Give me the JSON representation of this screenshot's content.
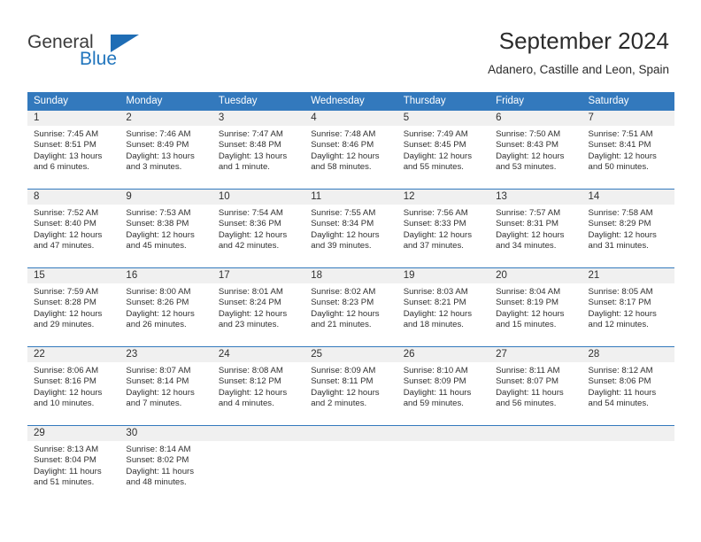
{
  "brand": {
    "name_part1": "General",
    "name_part2": "Blue",
    "triangle_icon": "blue-triangle-icon",
    "accent_color": "#2175bd"
  },
  "header": {
    "title": "September 2024",
    "subtitle": "Adanero, Castille and Leon, Spain"
  },
  "calendar": {
    "header_bg_color": "#3379bd",
    "day_number_bg_color": "#f0f0f0",
    "weekdays": [
      "Sunday",
      "Monday",
      "Tuesday",
      "Wednesday",
      "Thursday",
      "Friday",
      "Saturday"
    ],
    "weeks": [
      [
        {
          "day": "1",
          "sunrise": "Sunrise: 7:45 AM",
          "sunset": "Sunset: 8:51 PM",
          "daylight": "Daylight: 13 hours and 6 minutes."
        },
        {
          "day": "2",
          "sunrise": "Sunrise: 7:46 AM",
          "sunset": "Sunset: 8:49 PM",
          "daylight": "Daylight: 13 hours and 3 minutes."
        },
        {
          "day": "3",
          "sunrise": "Sunrise: 7:47 AM",
          "sunset": "Sunset: 8:48 PM",
          "daylight": "Daylight: 13 hours and 1 minute."
        },
        {
          "day": "4",
          "sunrise": "Sunrise: 7:48 AM",
          "sunset": "Sunset: 8:46 PM",
          "daylight": "Daylight: 12 hours and 58 minutes."
        },
        {
          "day": "5",
          "sunrise": "Sunrise: 7:49 AM",
          "sunset": "Sunset: 8:45 PM",
          "daylight": "Daylight: 12 hours and 55 minutes."
        },
        {
          "day": "6",
          "sunrise": "Sunrise: 7:50 AM",
          "sunset": "Sunset: 8:43 PM",
          "daylight": "Daylight: 12 hours and 53 minutes."
        },
        {
          "day": "7",
          "sunrise": "Sunrise: 7:51 AM",
          "sunset": "Sunset: 8:41 PM",
          "daylight": "Daylight: 12 hours and 50 minutes."
        }
      ],
      [
        {
          "day": "8",
          "sunrise": "Sunrise: 7:52 AM",
          "sunset": "Sunset: 8:40 PM",
          "daylight": "Daylight: 12 hours and 47 minutes."
        },
        {
          "day": "9",
          "sunrise": "Sunrise: 7:53 AM",
          "sunset": "Sunset: 8:38 PM",
          "daylight": "Daylight: 12 hours and 45 minutes."
        },
        {
          "day": "10",
          "sunrise": "Sunrise: 7:54 AM",
          "sunset": "Sunset: 8:36 PM",
          "daylight": "Daylight: 12 hours and 42 minutes."
        },
        {
          "day": "11",
          "sunrise": "Sunrise: 7:55 AM",
          "sunset": "Sunset: 8:34 PM",
          "daylight": "Daylight: 12 hours and 39 minutes."
        },
        {
          "day": "12",
          "sunrise": "Sunrise: 7:56 AM",
          "sunset": "Sunset: 8:33 PM",
          "daylight": "Daylight: 12 hours and 37 minutes."
        },
        {
          "day": "13",
          "sunrise": "Sunrise: 7:57 AM",
          "sunset": "Sunset: 8:31 PM",
          "daylight": "Daylight: 12 hours and 34 minutes."
        },
        {
          "day": "14",
          "sunrise": "Sunrise: 7:58 AM",
          "sunset": "Sunset: 8:29 PM",
          "daylight": "Daylight: 12 hours and 31 minutes."
        }
      ],
      [
        {
          "day": "15",
          "sunrise": "Sunrise: 7:59 AM",
          "sunset": "Sunset: 8:28 PM",
          "daylight": "Daylight: 12 hours and 29 minutes."
        },
        {
          "day": "16",
          "sunrise": "Sunrise: 8:00 AM",
          "sunset": "Sunset: 8:26 PM",
          "daylight": "Daylight: 12 hours and 26 minutes."
        },
        {
          "day": "17",
          "sunrise": "Sunrise: 8:01 AM",
          "sunset": "Sunset: 8:24 PM",
          "daylight": "Daylight: 12 hours and 23 minutes."
        },
        {
          "day": "18",
          "sunrise": "Sunrise: 8:02 AM",
          "sunset": "Sunset: 8:23 PM",
          "daylight": "Daylight: 12 hours and 21 minutes."
        },
        {
          "day": "19",
          "sunrise": "Sunrise: 8:03 AM",
          "sunset": "Sunset: 8:21 PM",
          "daylight": "Daylight: 12 hours and 18 minutes."
        },
        {
          "day": "20",
          "sunrise": "Sunrise: 8:04 AM",
          "sunset": "Sunset: 8:19 PM",
          "daylight": "Daylight: 12 hours and 15 minutes."
        },
        {
          "day": "21",
          "sunrise": "Sunrise: 8:05 AM",
          "sunset": "Sunset: 8:17 PM",
          "daylight": "Daylight: 12 hours and 12 minutes."
        }
      ],
      [
        {
          "day": "22",
          "sunrise": "Sunrise: 8:06 AM",
          "sunset": "Sunset: 8:16 PM",
          "daylight": "Daylight: 12 hours and 10 minutes."
        },
        {
          "day": "23",
          "sunrise": "Sunrise: 8:07 AM",
          "sunset": "Sunset: 8:14 PM",
          "daylight": "Daylight: 12 hours and 7 minutes."
        },
        {
          "day": "24",
          "sunrise": "Sunrise: 8:08 AM",
          "sunset": "Sunset: 8:12 PM",
          "daylight": "Daylight: 12 hours and 4 minutes."
        },
        {
          "day": "25",
          "sunrise": "Sunrise: 8:09 AM",
          "sunset": "Sunset: 8:11 PM",
          "daylight": "Daylight: 12 hours and 2 minutes."
        },
        {
          "day": "26",
          "sunrise": "Sunrise: 8:10 AM",
          "sunset": "Sunset: 8:09 PM",
          "daylight": "Daylight: 11 hours and 59 minutes."
        },
        {
          "day": "27",
          "sunrise": "Sunrise: 8:11 AM",
          "sunset": "Sunset: 8:07 PM",
          "daylight": "Daylight: 11 hours and 56 minutes."
        },
        {
          "day": "28",
          "sunrise": "Sunrise: 8:12 AM",
          "sunset": "Sunset: 8:06 PM",
          "daylight": "Daylight: 11 hours and 54 minutes."
        }
      ],
      [
        {
          "day": "29",
          "sunrise": "Sunrise: 8:13 AM",
          "sunset": "Sunset: 8:04 PM",
          "daylight": "Daylight: 11 hours and 51 minutes."
        },
        {
          "day": "30",
          "sunrise": "Sunrise: 8:14 AM",
          "sunset": "Sunset: 8:02 PM",
          "daylight": "Daylight: 11 hours and 48 minutes."
        },
        {
          "day": "",
          "sunrise": "",
          "sunset": "",
          "daylight": ""
        },
        {
          "day": "",
          "sunrise": "",
          "sunset": "",
          "daylight": ""
        },
        {
          "day": "",
          "sunrise": "",
          "sunset": "",
          "daylight": ""
        },
        {
          "day": "",
          "sunrise": "",
          "sunset": "",
          "daylight": ""
        },
        {
          "day": "",
          "sunrise": "",
          "sunset": "",
          "daylight": ""
        }
      ]
    ]
  }
}
